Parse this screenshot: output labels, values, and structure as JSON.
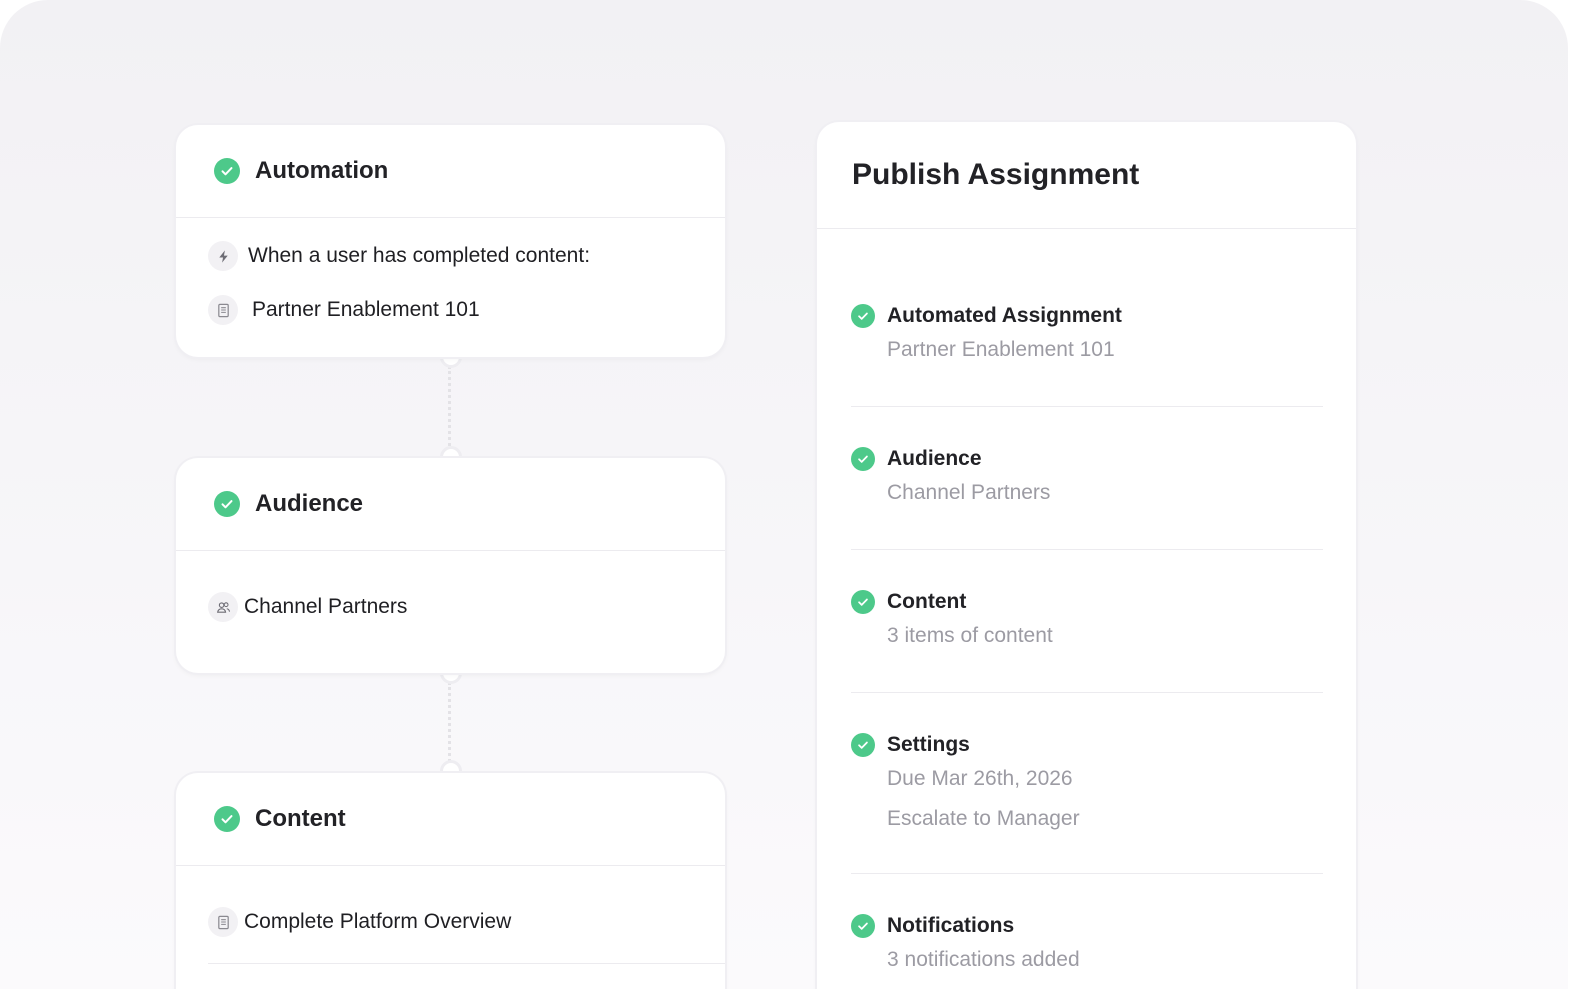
{
  "workflow": {
    "automation": {
      "title": "Automation",
      "trigger_label": "When a user has completed content:",
      "trigger_icon": "bolt-icon",
      "content_label": "Partner Enablement 101",
      "content_icon": "document-icon"
    },
    "audience": {
      "title": "Audience",
      "item_label": "Channel Partners",
      "item_icon": "users-icon"
    },
    "content": {
      "title": "Content",
      "item_label": "Complete Platform Overview",
      "item_icon": "document-icon"
    }
  },
  "publish_panel": {
    "title": "Publish Assignment",
    "steps": [
      {
        "title": "Automated Assignment",
        "details": [
          "Partner Enablement 101"
        ]
      },
      {
        "title": "Audience",
        "details": [
          "Channel Partners"
        ]
      },
      {
        "title": "Content",
        "details": [
          "3 items of content"
        ]
      },
      {
        "title": "Settings",
        "details": [
          "Due Mar 26th, 2026",
          "Escalate to Manager"
        ]
      },
      {
        "title": "Notifications",
        "details": [
          "3 notifications added"
        ]
      }
    ]
  },
  "colors": {
    "check_green": "#4dc98a",
    "muted_text": "#9c9ba3",
    "background": "#f4f3f6"
  }
}
